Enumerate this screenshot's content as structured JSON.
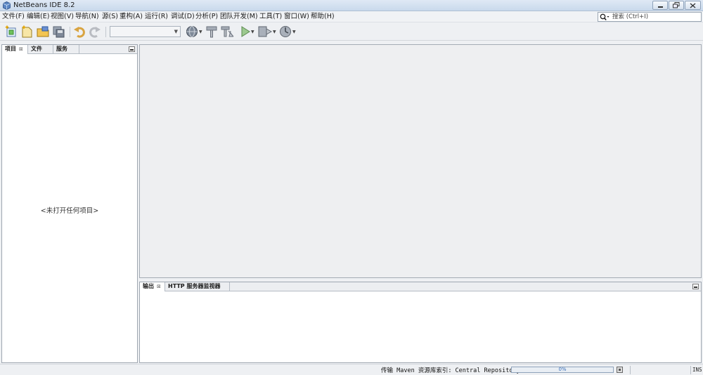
{
  "window": {
    "title": "NetBeans IDE 8.2"
  },
  "menu": [
    "文件(F)",
    "编辑(E)",
    "视图(V)",
    "导航(N)",
    "源(S)",
    "重构(A)",
    "运行(R)",
    "调试(D)",
    "分析(P)",
    "团队开发(M)",
    "工具(T)",
    "窗口(W)",
    "帮助(H)"
  ],
  "search": {
    "placeholder": "搜索 (Ctrl+I)"
  },
  "toolbar": {
    "icons": [
      "new-project-icon",
      "new-file-icon",
      "open-project-icon",
      "save-all-icon",
      "undo-icon",
      "redo-icon",
      "run-config-select",
      "browser-globe-icon",
      "build-hammer-icon",
      "clean-build-icon",
      "run-play-icon",
      "debug-icon",
      "profile-icon"
    ],
    "config_value": ""
  },
  "left_panel": {
    "tabs": [
      "项目",
      "文件",
      "服务"
    ],
    "active_tab": "项目",
    "close_symbol": "⊠",
    "empty_message": "<未打开任何项目>"
  },
  "output_panel": {
    "tabs": [
      "输出",
      "HTTP 服务器监视器"
    ],
    "active_tab": "输出",
    "close_symbol": "⊠"
  },
  "status": {
    "task_text": "传输 Maven 资源库索引: Central Repository",
    "progress_label": "0%",
    "progress_fraction": 0.0,
    "insert_mode": "INS"
  },
  "colors": {
    "accent": "#2c67b5",
    "title_bar": "#c9d9ec"
  }
}
